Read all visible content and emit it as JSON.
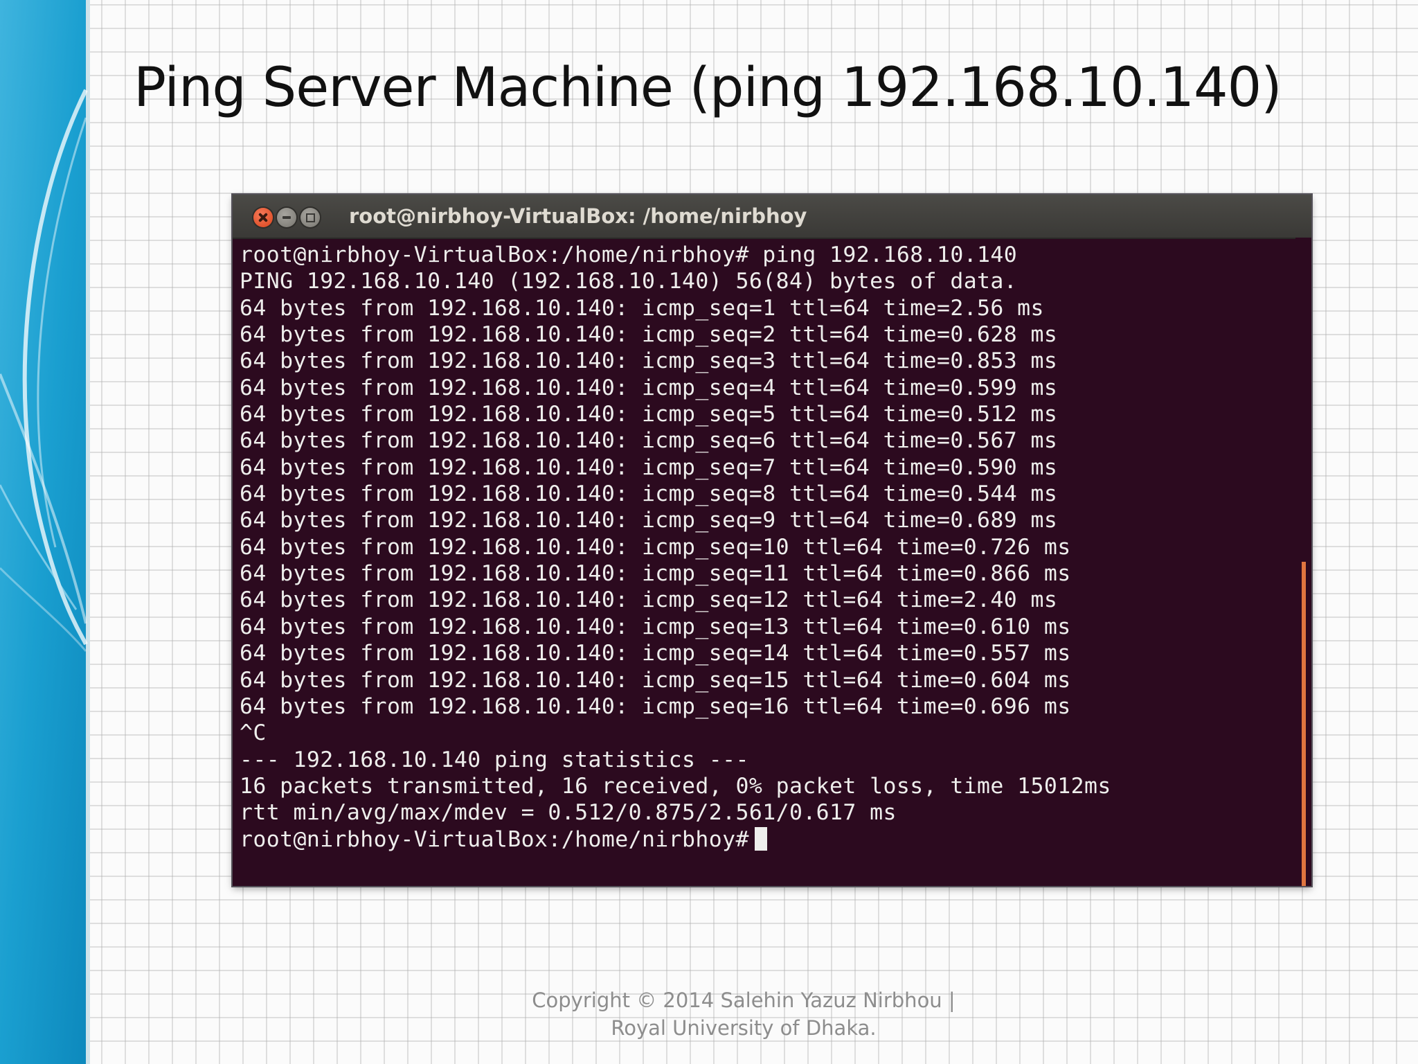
{
  "slide": {
    "title": "Ping Server Machine (ping 192.168.10.140)",
    "footer_line1": "Copyright © 2014 Salehin Yazuz Nirbhou |",
    "footer_line2": "Royal University of Dhaka."
  },
  "terminal": {
    "window_title": "root@nirbhoy-VirtualBox: /home/nirbhoy",
    "lines": [
      "root@nirbhoy-VirtualBox:/home/nirbhoy# ping 192.168.10.140",
      "PING 192.168.10.140 (192.168.10.140) 56(84) bytes of data.",
      "64 bytes from 192.168.10.140: icmp_seq=1 ttl=64 time=2.56 ms",
      "64 bytes from 192.168.10.140: icmp_seq=2 ttl=64 time=0.628 ms",
      "64 bytes from 192.168.10.140: icmp_seq=3 ttl=64 time=0.853 ms",
      "64 bytes from 192.168.10.140: icmp_seq=4 ttl=64 time=0.599 ms",
      "64 bytes from 192.168.10.140: icmp_seq=5 ttl=64 time=0.512 ms",
      "64 bytes from 192.168.10.140: icmp_seq=6 ttl=64 time=0.567 ms",
      "64 bytes from 192.168.10.140: icmp_seq=7 ttl=64 time=0.590 ms",
      "64 bytes from 192.168.10.140: icmp_seq=8 ttl=64 time=0.544 ms",
      "64 bytes from 192.168.10.140: icmp_seq=9 ttl=64 time=0.689 ms",
      "64 bytes from 192.168.10.140: icmp_seq=10 ttl=64 time=0.726 ms",
      "64 bytes from 192.168.10.140: icmp_seq=11 ttl=64 time=0.866 ms",
      "64 bytes from 192.168.10.140: icmp_seq=12 ttl=64 time=2.40 ms",
      "64 bytes from 192.168.10.140: icmp_seq=13 ttl=64 time=0.610 ms",
      "64 bytes from 192.168.10.140: icmp_seq=14 ttl=64 time=0.557 ms",
      "64 bytes from 192.168.10.140: icmp_seq=15 ttl=64 time=0.604 ms",
      "64 bytes from 192.168.10.140: icmp_seq=16 ttl=64 time=0.696 ms",
      "^C",
      "--- 192.168.10.140 ping statistics ---",
      "16 packets transmitted, 16 received, 0% packet loss, time 15012ms",
      "rtt min/avg/max/mdev = 0.512/0.875/2.561/0.617 ms"
    ],
    "prompt": "root@nirbhoy-VirtualBox:/home/nirbhoy#",
    "window_buttons": [
      "close-icon",
      "minimize-icon",
      "maximize-icon"
    ]
  },
  "colors": {
    "terminal_bg": "#2c0a1f",
    "terminal_text": "#eeeeec",
    "titlebar": "#3f3e3a",
    "close_button": "#e9592f",
    "scrollbar_accent": "#e0753f",
    "side_band": "#1ea3cf",
    "title_text": "#111111",
    "footer_text": "#8d8d8d"
  }
}
